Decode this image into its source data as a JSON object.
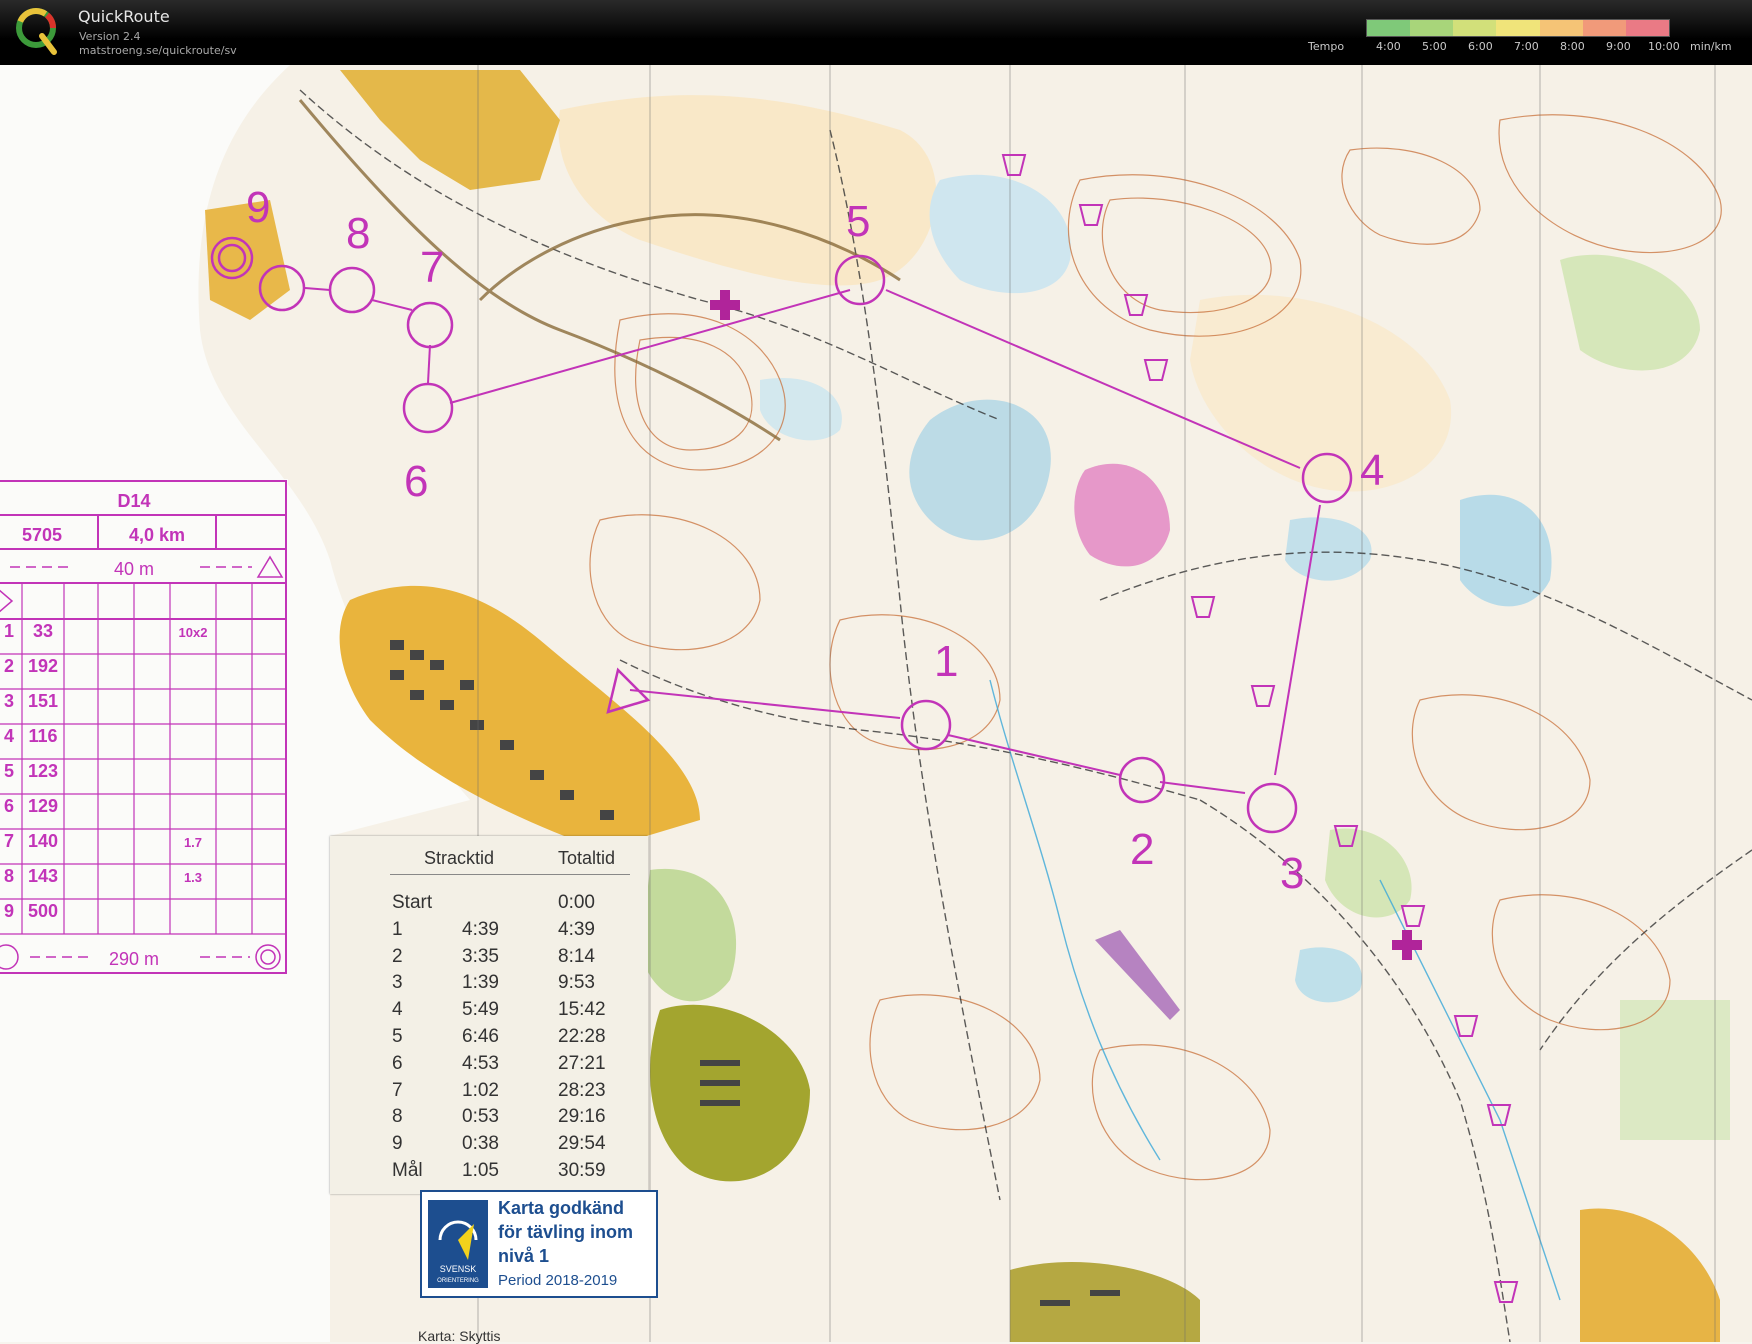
{
  "app": {
    "title": "QuickRoute",
    "version": "Version 2.4",
    "url": "matstroeng.se/quickroute/sv"
  },
  "tempo": {
    "label": "Tempo",
    "ticks": [
      "4:00",
      "5:00",
      "6:00",
      "7:00",
      "8:00",
      "9:00",
      "10:00"
    ],
    "unit": "min/km",
    "colors": [
      "#7fc979",
      "#a8d57a",
      "#d2e07a",
      "#f0e47a",
      "#f5c476",
      "#f19a7a",
      "#ea7a85"
    ]
  },
  "course": {
    "class": "D14",
    "number": "5705",
    "length": "4,0 km",
    "climb_row": "40 m",
    "finish_row": "290 m",
    "controls": [
      {
        "n": "1",
        "code": "33",
        "dim": "10x2"
      },
      {
        "n": "2",
        "code": "192",
        "dim": ""
      },
      {
        "n": "3",
        "code": "151",
        "dim": ""
      },
      {
        "n": "4",
        "code": "116",
        "dim": ""
      },
      {
        "n": "5",
        "code": "123",
        "dim": ""
      },
      {
        "n": "6",
        "code": "129",
        "dim": ""
      },
      {
        "n": "7",
        "code": "140",
        "dim": "1.7"
      },
      {
        "n": "8",
        "code": "143",
        "dim": "1.3"
      },
      {
        "n": "9",
        "code": "500",
        "dim": ""
      }
    ],
    "map_labels": [
      "1",
      "2",
      "3",
      "4",
      "5",
      "6",
      "7",
      "8",
      "9"
    ]
  },
  "splits": {
    "col_leg": "Stracktid",
    "col_total": "Totaltid",
    "rows": [
      {
        "ctrl": "Start",
        "leg": "",
        "total": "0:00"
      },
      {
        "ctrl": "1",
        "leg": "4:39",
        "total": "4:39"
      },
      {
        "ctrl": "2",
        "leg": "3:35",
        "total": "8:14"
      },
      {
        "ctrl": "3",
        "leg": "1:39",
        "total": "9:53"
      },
      {
        "ctrl": "4",
        "leg": "5:49",
        "total": "15:42"
      },
      {
        "ctrl": "5",
        "leg": "6:46",
        "total": "22:28"
      },
      {
        "ctrl": "6",
        "leg": "4:53",
        "total": "27:21"
      },
      {
        "ctrl": "7",
        "leg": "1:02",
        "total": "28:23"
      },
      {
        "ctrl": "8",
        "leg": "0:53",
        "total": "29:16"
      },
      {
        "ctrl": "9",
        "leg": "0:38",
        "total": "29:54"
      },
      {
        "ctrl": "Mål",
        "leg": "1:05",
        "total": "30:59"
      }
    ]
  },
  "badge": {
    "line1": "Karta godkänd",
    "line2": "för tävling inom",
    "line3": "nivå 1",
    "period": "Period 2018-2019",
    "logo_text1": "SVENSK",
    "logo_text2": "ORIENTERING"
  },
  "footer_text": "Karta: Skyttis"
}
